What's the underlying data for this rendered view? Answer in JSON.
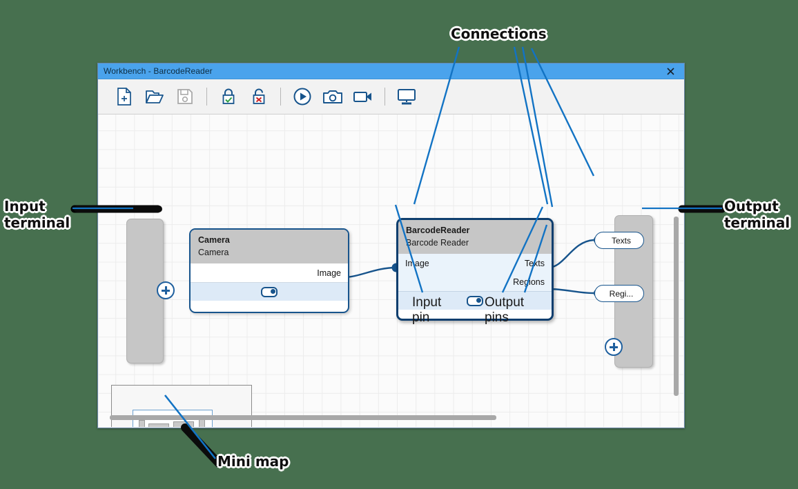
{
  "window": {
    "title": "Workbench - BarcodeReader",
    "close_icon": "close-icon"
  },
  "toolbar": {
    "items": [
      {
        "name": "new-file-icon",
        "label": "New",
        "state": "enabled"
      },
      {
        "name": "open-folder-icon",
        "label": "Open",
        "state": "enabled"
      },
      {
        "name": "save-icon",
        "label": "Save",
        "state": "disabled"
      },
      {
        "name": "lock-icon",
        "label": "Lock",
        "state": "enabled"
      },
      {
        "name": "unlock-icon",
        "label": "Unlock",
        "state": "enabled"
      },
      {
        "name": "play-icon",
        "label": "Run",
        "state": "enabled"
      },
      {
        "name": "camera-icon",
        "label": "Snapshot",
        "state": "enabled"
      },
      {
        "name": "video-camera-icon",
        "label": "Record",
        "state": "enabled"
      },
      {
        "name": "monitor-icon",
        "label": "Display",
        "state": "enabled"
      }
    ]
  },
  "nodes": [
    {
      "id": "camera",
      "title": "Camera",
      "subtitle": "Camera",
      "inputs": [],
      "outputs": [
        "Image"
      ],
      "selected": false,
      "toggle_on": true
    },
    {
      "id": "barcode-reader",
      "title": "BarcodeReader",
      "subtitle": "Barcode Reader",
      "inputs": [
        "Image"
      ],
      "outputs": [
        "Texts",
        "Regions"
      ],
      "selected": true,
      "toggle_on": true
    }
  ],
  "input_terminal": {
    "add_label": "+"
  },
  "output_terminal": {
    "pins": [
      "Texts",
      "Regi..."
    ],
    "add_label": "+"
  },
  "annotations": {
    "connections": "Connections",
    "input_terminal": "Input\nterminal",
    "output_terminal": "Output\nterminal",
    "input_pin": "Input\npin",
    "output_pins": "Output\npins",
    "mini_map": "Mini map"
  },
  "colors": {
    "backdrop": "#47704f",
    "titlebar": "#4aa3ec",
    "accent_blue": "#17548c",
    "node_header": "#c6c6c6",
    "selected_body": "#eaf3fb",
    "terminal_fill": "#c6c6c6",
    "lock_check": "#2f9e44",
    "lock_cross": "#cc2020"
  }
}
